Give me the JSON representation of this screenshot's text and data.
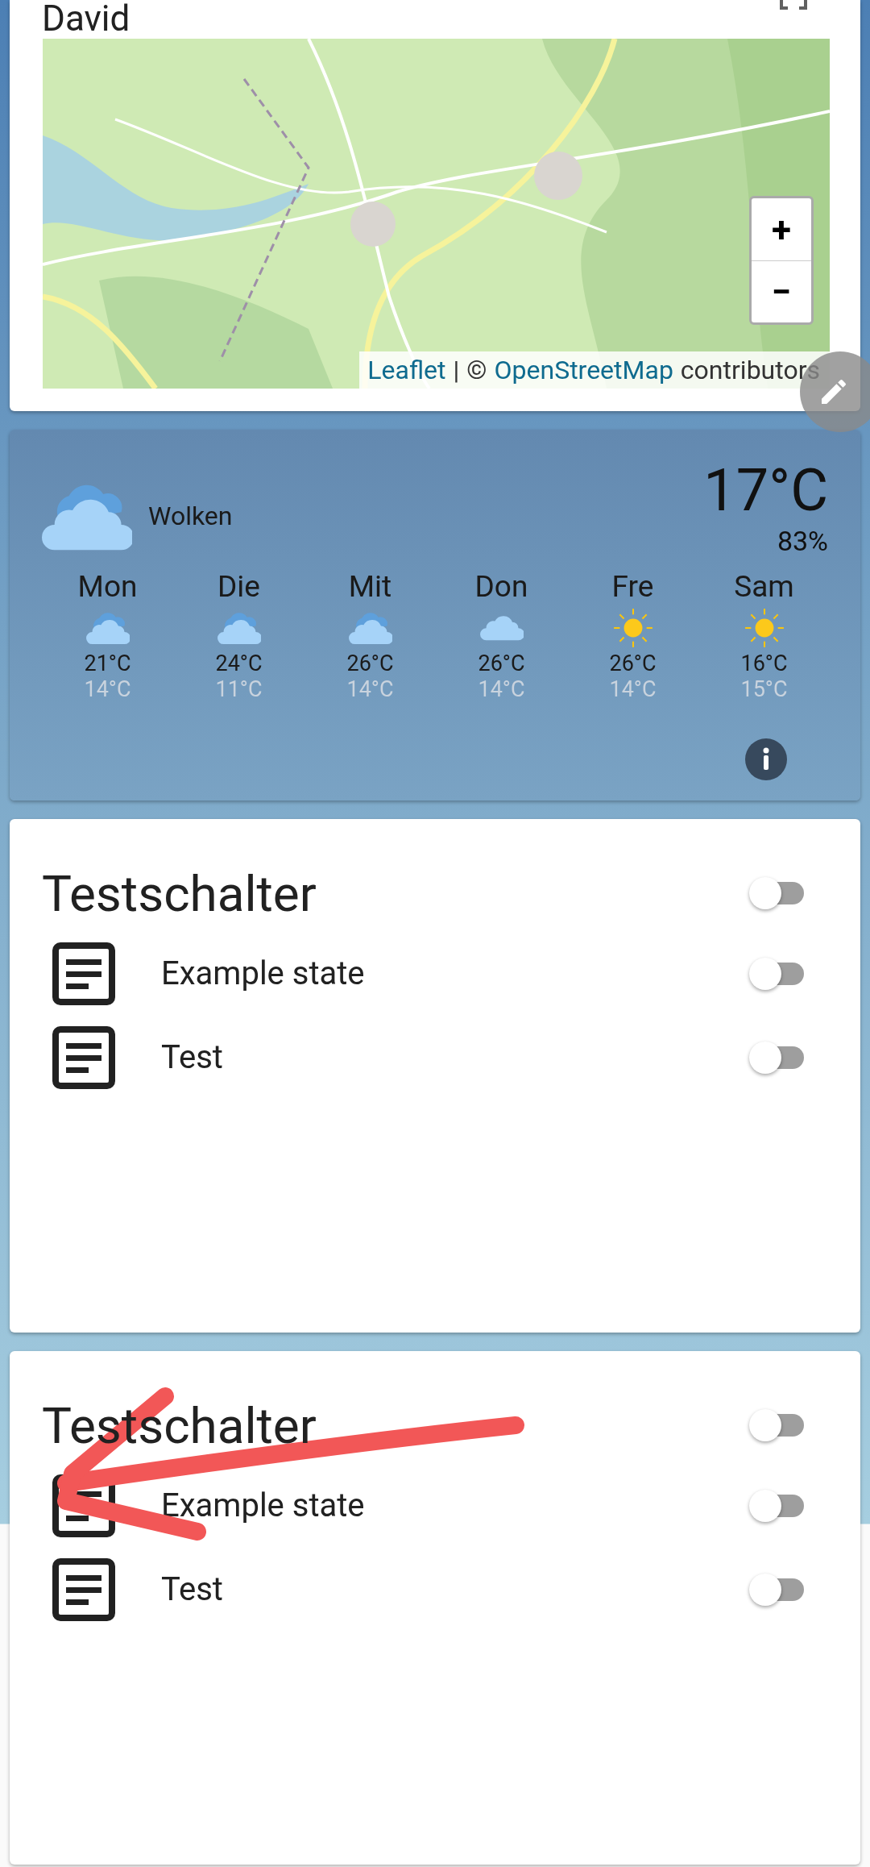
{
  "map_card": {
    "title": "David",
    "zoom_in": "+",
    "zoom_out": "−",
    "attribution": [
      {
        "kind": "link",
        "text": "Leaflet"
      },
      {
        "kind": "text",
        "text": "|"
      },
      {
        "kind": "text",
        "text": "©"
      },
      {
        "kind": "link",
        "text": "OpenStreetMap"
      },
      {
        "kind": "text",
        "text": "contributors"
      }
    ]
  },
  "weather": {
    "condition": "Wolken",
    "kind": "clouds",
    "temperature": "17°C",
    "humidity": "83%",
    "forecast": [
      {
        "day": "Mon",
        "kind": "clouds",
        "high": "21°C",
        "low": "14°C"
      },
      {
        "day": "Die",
        "kind": "clouds",
        "high": "24°C",
        "low": "11°C"
      },
      {
        "day": "Mit",
        "kind": "clouds",
        "high": "26°C",
        "low": "14°C"
      },
      {
        "day": "Don",
        "kind": "cloud",
        "high": "26°C",
        "low": "14°C"
      },
      {
        "day": "Fre",
        "kind": "sunny",
        "high": "26°C",
        "low": "14°C"
      },
      {
        "day": "Sam",
        "kind": "sunny",
        "high": "16°C",
        "low": "15°C"
      }
    ]
  },
  "cards": [
    {
      "title": "Testschalter",
      "on": false,
      "entities": [
        {
          "name": "Example state",
          "on": false
        },
        {
          "name": "Test",
          "on": false
        }
      ]
    },
    {
      "title": "Testschalter",
      "on": false,
      "entities": [
        {
          "name": "Example state",
          "on": false
        },
        {
          "name": "Test",
          "on": false
        }
      ]
    }
  ]
}
